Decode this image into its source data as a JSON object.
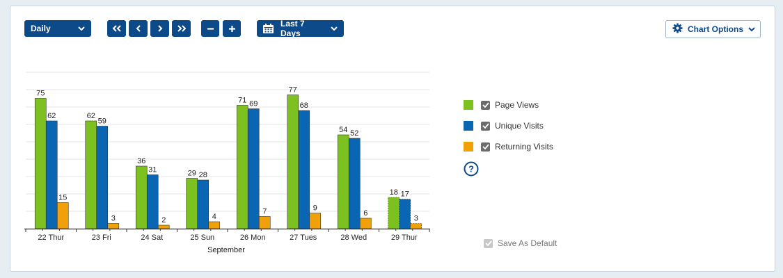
{
  "toolbar": {
    "interval_label": "Daily",
    "range_label": "Last 7 Days",
    "chart_options_label": "Chart Options"
  },
  "colors": {
    "page_views": "#7cc11f",
    "unique_visits": "#0a66b3",
    "returning_visits": "#f0a10a",
    "button": "#0d4a8a"
  },
  "legend": {
    "items": [
      {
        "label": "Page Views",
        "checked": true
      },
      {
        "label": "Unique Visits",
        "checked": true
      },
      {
        "label": "Returning Visits",
        "checked": true
      }
    ],
    "save_default_label": "Save As Default"
  },
  "chart_data": {
    "type": "bar",
    "xlabel": "September",
    "ylabel": "",
    "ylim": [
      0,
      90
    ],
    "grid": true,
    "legend_position": "right",
    "categories": [
      "22 Thur",
      "23 Fri",
      "24 Sat",
      "25 Sun",
      "26 Mon",
      "27 Tues",
      "28 Wed",
      "29 Thur"
    ],
    "series": [
      {
        "name": "Page Views",
        "values": [
          75,
          62,
          36,
          29,
          71,
          77,
          54,
          18
        ]
      },
      {
        "name": "Unique Visits",
        "values": [
          62,
          59,
          31,
          28,
          69,
          68,
          52,
          17
        ]
      },
      {
        "name": "Returning Visits",
        "values": [
          15,
          3,
          2,
          4,
          7,
          9,
          6,
          3
        ]
      }
    ]
  }
}
